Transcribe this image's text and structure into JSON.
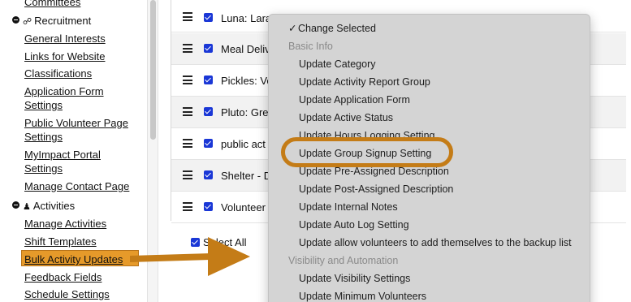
{
  "sidebar": {
    "top_partial": "Committees",
    "recruitment": {
      "heading": "Recruitment",
      "links": [
        "General Interests",
        "Links for Website",
        "Classifications",
        "Application Form",
        "Settings",
        "Public Volunteer Page",
        "Settings",
        "MyImpact Portal",
        "Settings",
        "Manage Contact Page"
      ]
    },
    "activities": {
      "heading": "Activities",
      "links": [
        "Manage Activities",
        "Shift Templates",
        "Bulk Activity Updates",
        "Feedback Fields",
        "Schedule Settings"
      ]
    }
  },
  "table": {
    "rows": [
      "Luna: Lara",
      "Meal Deliv",
      "Pickles: Ve",
      "Pluto: Gre",
      "public act",
      "Shelter - D",
      "Volunteer"
    ],
    "select_all": "Select All"
  },
  "dropdown": {
    "selected": "Change Selected",
    "group_basic": "Basic Info",
    "basic_options": [
      "Update Category",
      "Update Activity Report Group",
      "Update Application Form",
      "Update Active Status",
      "Update Hours Logging Setting",
      "Update Group Signup Setting",
      "Update Pre-Assigned Description",
      "Update Post-Assigned Description",
      "Update Internal Notes",
      "Update Auto Log Setting",
      "Update allow volunteers to add themselves to the backup list"
    ],
    "group_visibility": "Visibility and Automation",
    "visibility_options": [
      "Update Visibility Settings",
      "Update Minimum Volunteers"
    ]
  },
  "annotations": {
    "highlight_color": "#c47c17",
    "box_fill": "#e69a2a",
    "arrow_color": "#c47c17"
  }
}
